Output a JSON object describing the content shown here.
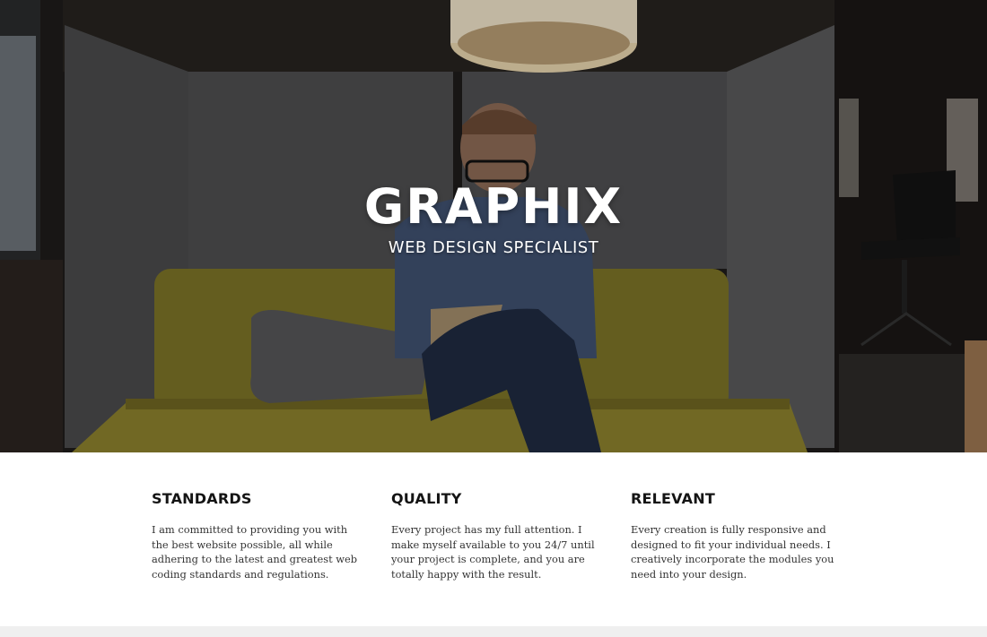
{
  "hero": {
    "title": "GRAPHIX",
    "subtitle": "WEB DESIGN SPECIALIST",
    "background": "photo-person-on-couch"
  },
  "features": [
    {
      "heading": "STANDARDS",
      "body": "I am committed to providing you with the best website possible, all while adhering to the latest and greatest web coding standards and regulations."
    },
    {
      "heading": "QUALITY",
      "body": "Every project has my full attention. I make myself available to you 24/7 until your project is complete, and you are totally happy with the result."
    },
    {
      "heading": "RELEVANT",
      "body": "Every creation is fully responsive and designed to fit your individual needs. I creatively incorporate the modules you need into your design."
    }
  ],
  "colors": {
    "heading": "#141414",
    "body_text": "#333333",
    "footer_strip": "#efefef"
  }
}
